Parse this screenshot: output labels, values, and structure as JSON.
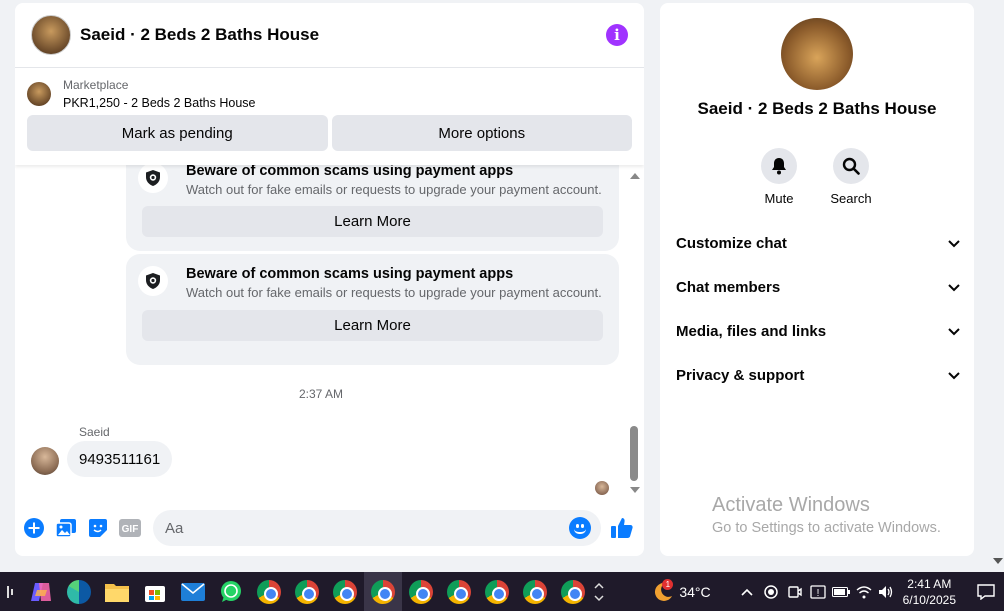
{
  "chat": {
    "title": "Saeid · 2 Beds 2 Baths House",
    "marketplace_label": "Marketplace",
    "listing": "PKR1,250 - 2 Beds 2 Baths House",
    "mark_pending": "Mark as pending",
    "more_options": "More options"
  },
  "cards": [
    {
      "title": "Beware of common scams using payment apps",
      "subtitle": "Watch out for fake emails or requests to upgrade your payment account.",
      "button": "Learn More"
    },
    {
      "title": "Beware of common scams using payment apps",
      "subtitle": "Watch out for fake emails or requests to upgrade your payment account.",
      "button": "Learn More"
    }
  ],
  "messages": {
    "timestamp": "2:37 AM",
    "sender": "Saeid",
    "text": "9493511161"
  },
  "composer": {
    "placeholder": "Aa",
    "gif_label": "GIF"
  },
  "info_panel": {
    "name": "Saeid · 2 Beds 2 Baths House",
    "mute_label": "Mute",
    "search_label": "Search",
    "sections": [
      "Customize chat",
      "Chat members",
      "Media, files and links",
      "Privacy & support"
    ]
  },
  "watermark": {
    "line1": "Activate Windows",
    "line2": "Go to Settings to activate Windows."
  },
  "taskbar": {
    "temperature": "34°C",
    "weather_badge": "1",
    "time": "2:41 AM",
    "date": "6/10/2025"
  },
  "colors": {
    "accent": "#0a7cff",
    "info_icon": "#a033ff",
    "taskbar_bg": "#1f1a2a"
  }
}
